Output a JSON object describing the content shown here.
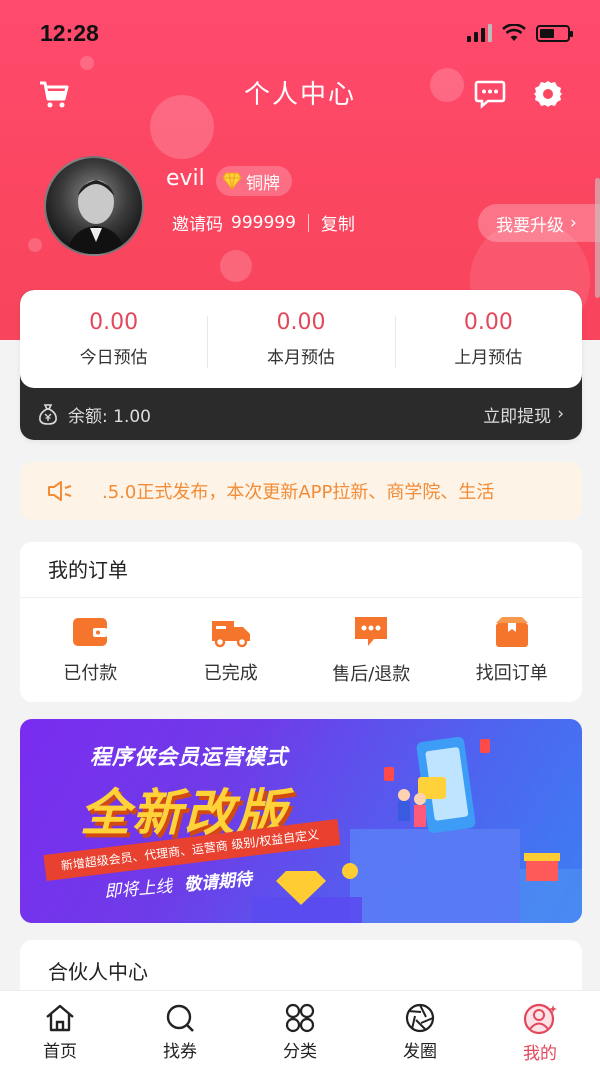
{
  "status": {
    "time": "12:28"
  },
  "header": {
    "title": "个人中心"
  },
  "profile": {
    "username": "evil",
    "badge": "铜牌",
    "invite_label": "邀请码",
    "invite_code": "999999",
    "copy_label": "复制",
    "upgrade_label": "我要升级"
  },
  "stats": [
    {
      "value": "0.00",
      "label": "今日预估"
    },
    {
      "value": "0.00",
      "label": "本月预估"
    },
    {
      "value": "0.00",
      "label": "上月预估"
    }
  ],
  "balance": {
    "label": "余额: 1.00",
    "withdraw_label": "立即提现"
  },
  "notice": {
    "text": ".5.0正式发布，本次更新APP拉新、商学院、生活"
  },
  "orders": {
    "title": "我的订单",
    "items": [
      {
        "label": "已付款",
        "icon": "wallet-icon"
      },
      {
        "label": "已完成",
        "icon": "truck-icon"
      },
      {
        "label": "售后/退款",
        "icon": "chat-dots-icon"
      },
      {
        "label": "找回订单",
        "icon": "box-icon"
      }
    ]
  },
  "banner": {
    "subtitle": "程序侠会员运营模式",
    "title": "全新改版",
    "ribbon": "新增超级会员、代理商、运营商 级别/权益自定义",
    "coming": "即将上线",
    "stay_tuned": "敬请期待"
  },
  "partner": {
    "title": "合伙人中心"
  },
  "tabbar": {
    "items": [
      {
        "label": "首页",
        "icon": "home-icon"
      },
      {
        "label": "找券",
        "icon": "search-icon"
      },
      {
        "label": "分类",
        "icon": "category-icon"
      },
      {
        "label": "发圈",
        "icon": "aperture-icon"
      },
      {
        "label": "我的",
        "icon": "user-icon"
      }
    ],
    "active_index": 4
  },
  "colors": {
    "primary": "#fb4660",
    "accent_red": "#e2475a",
    "notice_orange": "#f28c37"
  }
}
